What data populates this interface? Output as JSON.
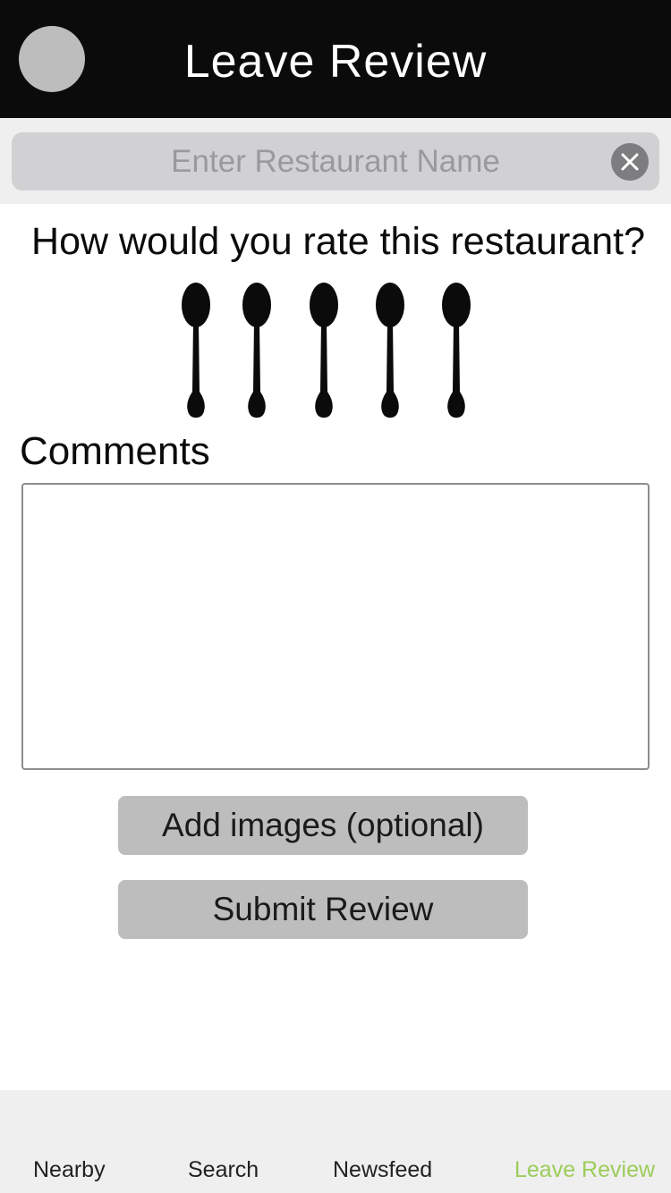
{
  "header": {
    "title": "Leave Review",
    "avatar_icon": "profile-avatar-icon"
  },
  "search": {
    "value": "",
    "placeholder": "Enter Restaurant Name",
    "clear_icon": "close-circle-icon"
  },
  "rating": {
    "question": "How would you rate this restaurant?",
    "icon": "spoon-icon",
    "max": 5,
    "value": 0
  },
  "comments": {
    "label": "Comments",
    "value": "",
    "placeholder": ""
  },
  "buttons": {
    "add_images": "Add images (optional)",
    "submit": "Submit Review"
  },
  "tabbar": {
    "tabs": [
      {
        "label": "Nearby",
        "active": false
      },
      {
        "label": "Search",
        "active": false
      },
      {
        "label": "Newsfeed",
        "active": false
      },
      {
        "label": "Leave Review",
        "active": true
      }
    ]
  },
  "colors": {
    "header_bg": "#0b0b0c",
    "accent_active_tab": "#9ccc5a",
    "button_bg": "#bdbdbe",
    "search_bg": "#d1d1d3"
  }
}
